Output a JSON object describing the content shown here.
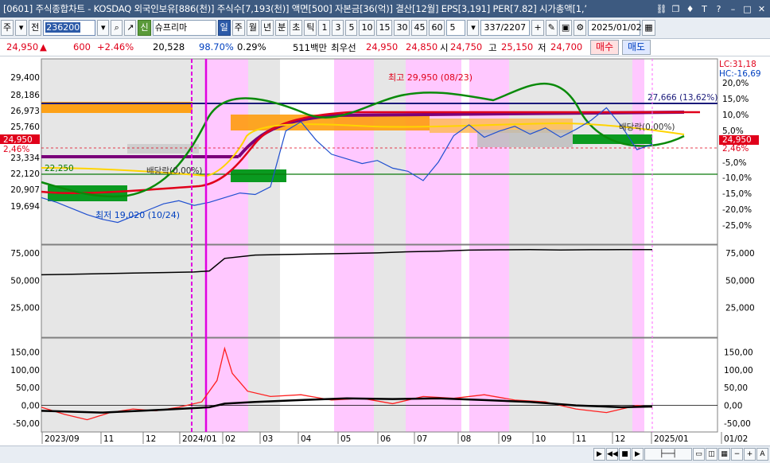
{
  "window": {
    "title": "[0601] 주식종합차트 - KOSDAQ 외국인보유[886(천)] 주식수[7,193(천)] 액면[500] 자본금[36(억)] 결산[12월] EPS[3,191] PER[7.82] 시가총액[1,’"
  },
  "toolbar": {
    "market": "주",
    "prev_label": "전",
    "code": "236200",
    "name": "슈프리마",
    "periods": [
      "일",
      "주",
      "월",
      "년",
      "분",
      "초",
      "틱"
    ],
    "intervals": [
      "1",
      "3",
      "5",
      "10",
      "15",
      "30",
      "45",
      "60"
    ],
    "interval_select": "5",
    "page": "337/2207",
    "date": "2025/01/02"
  },
  "quote": {
    "price": "24,950",
    "arrow": "▲",
    "change": "600",
    "change_pct": "+2.46%",
    "volume": "20,528",
    "vol_ratio": "98.70%",
    "turnover": "0.29%",
    "amount": "511백만",
    "best_label": "최우선",
    "ask": "24,950",
    "bid": "24,850",
    "open_label": "시",
    "open": "24,750",
    "high_label": "고",
    "high": "25,150",
    "low_label": "저",
    "low": "24,700",
    "buy_label": "매수",
    "sell_label": "매도"
  },
  "colors": {
    "up": "#e0001a",
    "down": "#0040c0",
    "pink_band": "#ffc8ff",
    "grey_band": "#e6e6e6",
    "title_bar": "#3d5a80"
  },
  "chart_data": [
    {
      "type": "line",
      "panel": "price",
      "y_ticks_left": [
        "29,400",
        "28,186",
        "26,973",
        "25,760",
        "24,950",
        "23,334",
        "22,120",
        "20,907",
        "19,694"
      ],
      "y_ticks_right": [
        "20,0%",
        "15,0%",
        "10,0%",
        "5,0%",
        "24,950",
        "2,46%",
        "-5,0%",
        "-10,0%",
        "-15,0%",
        "-20,0%",
        "-25,0%"
      ],
      "ylim": [
        18800,
        30200
      ],
      "annotations": {
        "lc": "LC:31,18",
        "hc": "HC:-16,69",
        "high": "최고 29,950 (08/23)",
        "low": "최저 19,020 (10/24)",
        "level_right": "27,666 (13,62%)",
        "div_right": "배당락(0,00%)",
        "div_left": "배당락(0,00%)",
        "level_left": "22,250",
        "cur_left": "24,950",
        "cur_pct": "2,46%"
      },
      "series": [
        {
          "x": [
            0,
            10,
            20,
            30,
            40,
            50,
            60,
            70,
            80,
            90,
            100,
            110,
            120,
            130,
            140,
            150,
            160,
            170,
            180,
            190,
            200,
            210,
            220,
            230,
            240,
            250,
            260,
            270,
            280,
            290,
            300,
            310,
            320,
            330,
            340,
            350,
            360,
            370,
            380,
            390,
            400
          ],
          "values": [
            21500,
            21200,
            20800,
            20400,
            20100,
            19900,
            20300,
            20700,
            21100,
            21300,
            21000,
            21200,
            21500,
            21800,
            21700,
            22200,
            25800,
            26400,
            25200,
            24300,
            24000,
            23700,
            23900,
            23400,
            23200,
            22600,
            23800,
            25500,
            26200,
            25400,
            25800,
            26100,
            25600,
            26000,
            25400,
            25900,
            26500,
            27300,
            26100,
            24600,
            24950
          ]
        }
      ]
    },
    {
      "type": "line",
      "panel": "volume",
      "y_ticks": [
        "75,000",
        "50,000",
        "25,000"
      ],
      "ylim": [
        0,
        80000
      ],
      "series": [
        {
          "x": [
            0,
            20,
            40,
            60,
            80,
            100,
            110,
            120,
            140,
            160,
            180,
            200,
            220,
            240,
            260,
            280,
            300,
            320,
            340,
            360,
            380,
            400
          ],
          "values": [
            55000,
            55500,
            56000,
            56500,
            57000,
            57500,
            58500,
            70000,
            73000,
            73500,
            74000,
            74500,
            75000,
            76000,
            76500,
            77500,
            77800,
            78000,
            77700,
            77900,
            78000,
            78000
          ]
        }
      ]
    },
    {
      "type": "line",
      "panel": "oscillator",
      "y_ticks": [
        "150,00",
        "100,00",
        "50,00",
        "0,00",
        "-50,00"
      ],
      "ylim": [
        -70,
        180
      ],
      "series": [
        {
          "x": [
            0,
            15,
            30,
            45,
            60,
            75,
            90,
            105,
            115,
            120,
            125,
            135,
            150,
            170,
            190,
            210,
            230,
            250,
            270,
            290,
            310,
            330,
            350,
            370,
            390,
            400
          ],
          "values": [
            -5,
            -25,
            -40,
            -20,
            -10,
            -15,
            -5,
            10,
            70,
            160,
            90,
            40,
            25,
            30,
            15,
            20,
            5,
            25,
            20,
            30,
            15,
            10,
            -10,
            -20,
            0,
            -5
          ]
        },
        {
          "x": [
            0,
            40,
            80,
            110,
            120,
            140,
            170,
            200,
            230,
            260,
            290,
            320,
            350,
            380,
            400
          ],
          "values": [
            -15,
            -20,
            -12,
            -5,
            5,
            10,
            15,
            20,
            18,
            20,
            15,
            10,
            0,
            -5,
            -3
          ]
        }
      ]
    }
  ],
  "x_axis": {
    "labels": [
      "2023/09",
      "11",
      "12",
      "2024/01",
      "02",
      "03",
      "04",
      "05",
      "06",
      "07",
      "08",
      "09",
      "10",
      "11",
      "12",
      "2025/01",
      "01/02"
    ]
  }
}
